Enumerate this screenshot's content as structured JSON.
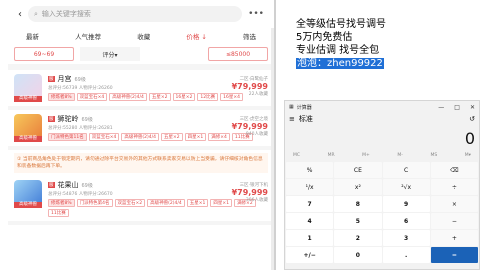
{
  "app": {
    "search_placeholder": "输入关键字搜索",
    "back_icon": "chevron-left-icon",
    "more_icon": "more-icon",
    "tabs": [
      {
        "label": "最新"
      },
      {
        "label": "人气推荐"
      },
      {
        "label": "收藏"
      },
      {
        "label": "价格 ↓"
      },
      {
        "label": "筛选"
      }
    ],
    "price_min": "69~69",
    "sort_label": "评分▾",
    "price_max": "≤85000"
  },
  "listings": [
    {
      "name": "月宫",
      "level": "69级",
      "sub": "总评分:56739 人物评分:26260",
      "tags": [
        "修炼者8%",
        "双蓝宝石×4",
        "高级神兽(2)4/4",
        "五星×2",
        "16星×2",
        "12比赛",
        "16星×4"
      ],
      "server": "二区·白鹭仙子",
      "price": "¥79,999",
      "collect": "22人收藏",
      "badge": "高级神兽"
    },
    {
      "name": "狮驼岭",
      "level": "69级",
      "sub": "总评分:55280 人物评分:26281",
      "tags": [
        "门派特色第11名",
        "双蓝宝石×4",
        "高级神兽(2)4/4",
        "五星×2",
        "四星×1",
        "满修×4",
        "11比赛"
      ],
      "server": "三区·虎空之境",
      "price": "¥79,999",
      "collect": "940人收藏",
      "badge": "高级神兽"
    },
    {
      "name": "花果山",
      "level": "69级",
      "sub": "总评分:54876 人物评分:26670",
      "tags": [
        "修炼者8%",
        "门派特色第4名",
        "双蓝宝石×2",
        "高级神兽(2)4/4",
        "五星×1",
        "四星×1",
        "满修×2",
        "11比赛"
      ],
      "server": "三区·银河下机",
      "price": "¥79,999",
      "collect": "306人收藏",
      "badge": "高级神兽"
    }
  ],
  "notice": "① 当前商品角色处于锁定期内，请勿通过除平台交易外的其他方式联系卖家交易以防上当受骗，请仔细核对角色信息和装备数据后再下单。",
  "ad": {
    "line1": "全等级估号找号调号",
    "line2": "5万内免费估",
    "line3": "专业估调 找号全包",
    "line4": "泡泡：zhen99922"
  },
  "calculator": {
    "title": "计算器",
    "mode": "标准",
    "display": "0",
    "memory": [
      "MC",
      "MR",
      "M+",
      "M-",
      "MS",
      "M▾"
    ],
    "keys": [
      "%",
      "CE",
      "C",
      "⌫",
      "¹/x",
      "x²",
      "²√x",
      "÷",
      "7",
      "8",
      "9",
      "×",
      "4",
      "5",
      "6",
      "−",
      "1",
      "2",
      "3",
      "+",
      "+/−",
      "0",
      ".",
      "="
    ]
  }
}
